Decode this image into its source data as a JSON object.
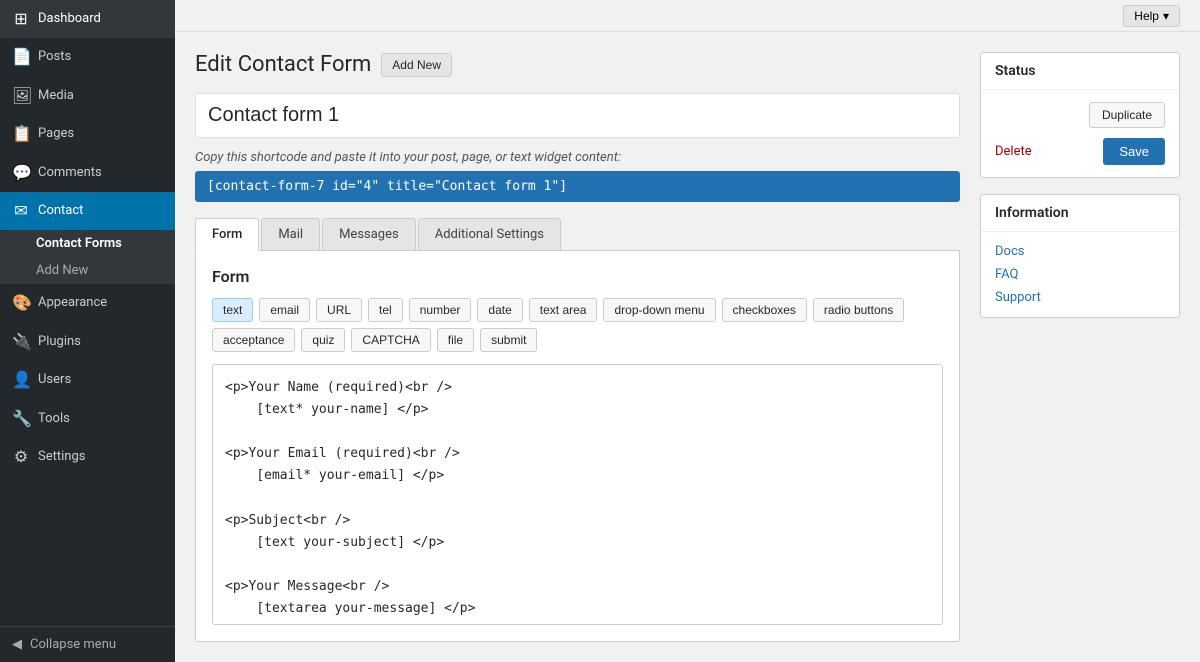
{
  "topbar": {
    "help_label": "Help",
    "help_icon": "▾"
  },
  "sidebar": {
    "items": [
      {
        "id": "dashboard",
        "label": "Dashboard",
        "icon": "⊞",
        "active": false
      },
      {
        "id": "posts",
        "label": "Posts",
        "icon": "📄",
        "active": false
      },
      {
        "id": "media",
        "label": "Media",
        "icon": "🖼",
        "active": false
      },
      {
        "id": "pages",
        "label": "Pages",
        "icon": "📋",
        "active": false
      },
      {
        "id": "comments",
        "label": "Comments",
        "icon": "💬",
        "active": false
      },
      {
        "id": "contact",
        "label": "Contact",
        "icon": "✉",
        "active": true
      }
    ],
    "contact_submenu": [
      {
        "id": "contact-forms",
        "label": "Contact Forms",
        "active": true
      },
      {
        "id": "add-new",
        "label": "Add New",
        "active": false
      }
    ],
    "bottom_items": [
      {
        "id": "appearance",
        "label": "Appearance",
        "icon": "🎨"
      },
      {
        "id": "plugins",
        "label": "Plugins",
        "icon": "🔌"
      },
      {
        "id": "users",
        "label": "Users",
        "icon": "👤"
      },
      {
        "id": "tools",
        "label": "Tools",
        "icon": "🔧"
      },
      {
        "id": "settings",
        "label": "Settings",
        "icon": "⚙"
      }
    ],
    "collapse_label": "Collapse menu"
  },
  "page": {
    "title": "Edit Contact Form",
    "add_new_label": "Add New",
    "form_name": "Contact form 1",
    "shortcode_label": "Copy this shortcode and paste it into your post, page, or text widget content:",
    "shortcode_value": "[contact-form-7 id=\"4\" title=\"Contact form 1\"]"
  },
  "tabs": [
    {
      "id": "form",
      "label": "Form",
      "active": true
    },
    {
      "id": "mail",
      "label": "Mail",
      "active": false
    },
    {
      "id": "messages",
      "label": "Messages",
      "active": false
    },
    {
      "id": "additional-settings",
      "label": "Additional Settings",
      "active": false
    }
  ],
  "form_editor": {
    "title": "Form",
    "tag_buttons": [
      {
        "id": "text",
        "label": "text",
        "highlighted": true
      },
      {
        "id": "email",
        "label": "email"
      },
      {
        "id": "url",
        "label": "URL"
      },
      {
        "id": "tel",
        "label": "tel"
      },
      {
        "id": "number",
        "label": "number"
      },
      {
        "id": "date",
        "label": "date"
      },
      {
        "id": "textarea",
        "label": "text area"
      },
      {
        "id": "dropdown",
        "label": "drop-down menu"
      },
      {
        "id": "checkboxes",
        "label": "checkboxes"
      },
      {
        "id": "radio",
        "label": "radio buttons"
      },
      {
        "id": "acceptance",
        "label": "acceptance"
      },
      {
        "id": "quiz",
        "label": "quiz"
      },
      {
        "id": "captcha",
        "label": "CAPTCHA"
      },
      {
        "id": "file",
        "label": "file"
      },
      {
        "id": "submit",
        "label": "submit"
      }
    ],
    "code_content": "<p>Your Name (required)<br />\n    [text* your-name] </p>\n\n<p>Your Email (required)<br />\n    [email* your-email] </p>\n\n<p>Subject<br />\n    [text your-subject] </p>\n\n<p>Your Message<br />\n    [textarea your-message] </p>\n\n<p>[submit \"Send\"]</p>"
  },
  "status_widget": {
    "title": "Status",
    "duplicate_label": "Duplicate",
    "delete_label": "Delete",
    "save_label": "Save"
  },
  "information_widget": {
    "title": "Information",
    "links": [
      {
        "id": "docs",
        "label": "Docs"
      },
      {
        "id": "faq",
        "label": "FAQ"
      },
      {
        "id": "support",
        "label": "Support"
      }
    ]
  }
}
